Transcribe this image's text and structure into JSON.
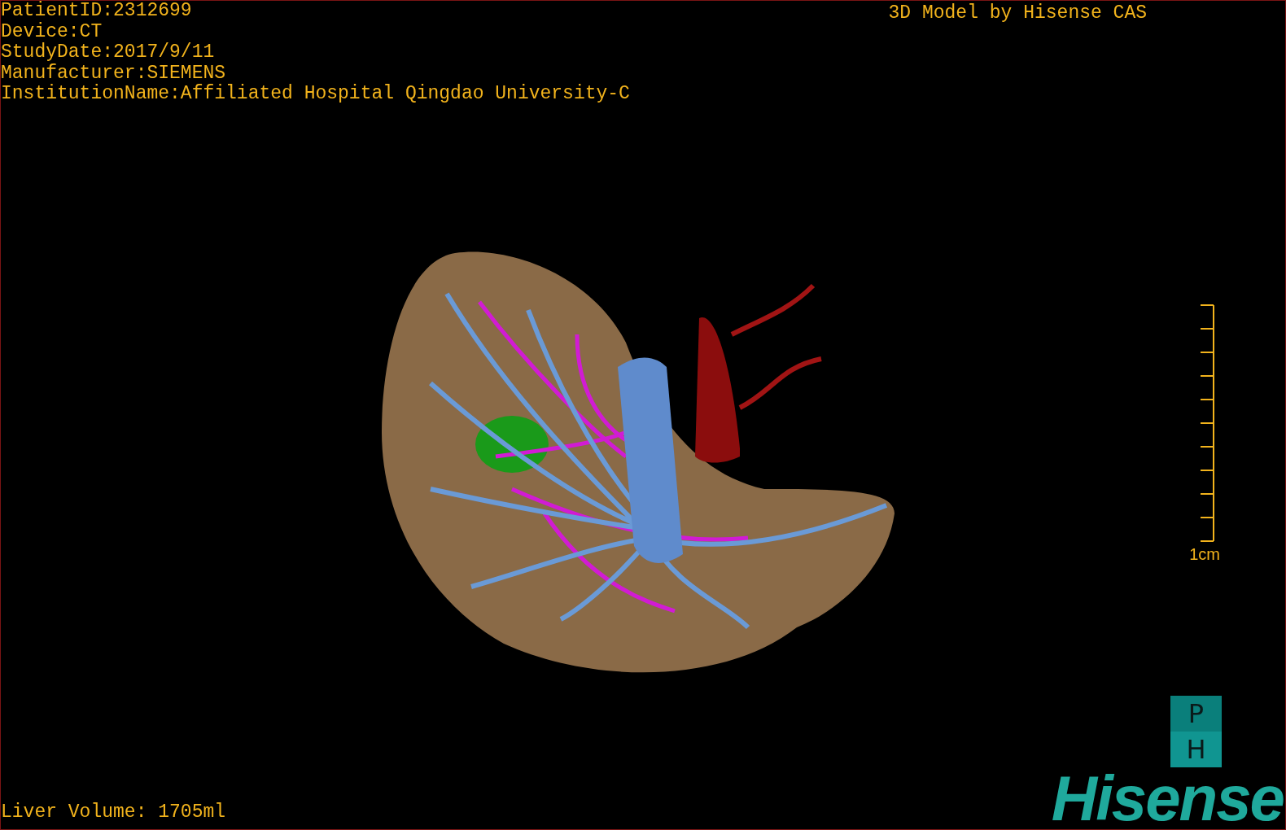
{
  "overlay": {
    "patient_info": [
      "PatientID:2312699",
      "Device:CT",
      "StudyDate:2017/9/11",
      "Manufacturer:SIEMENS",
      "InstitutionName:Affiliated Hospital Qingdao University-C"
    ],
    "title": "3D Model by Hisense CAS"
  },
  "scale_bar": {
    "label": "1cm"
  },
  "liver_volume": "Liver Volume: 1705ml",
  "logo": {
    "badge_letters": [
      "P",
      "H"
    ],
    "wordmark": "Hisense"
  }
}
